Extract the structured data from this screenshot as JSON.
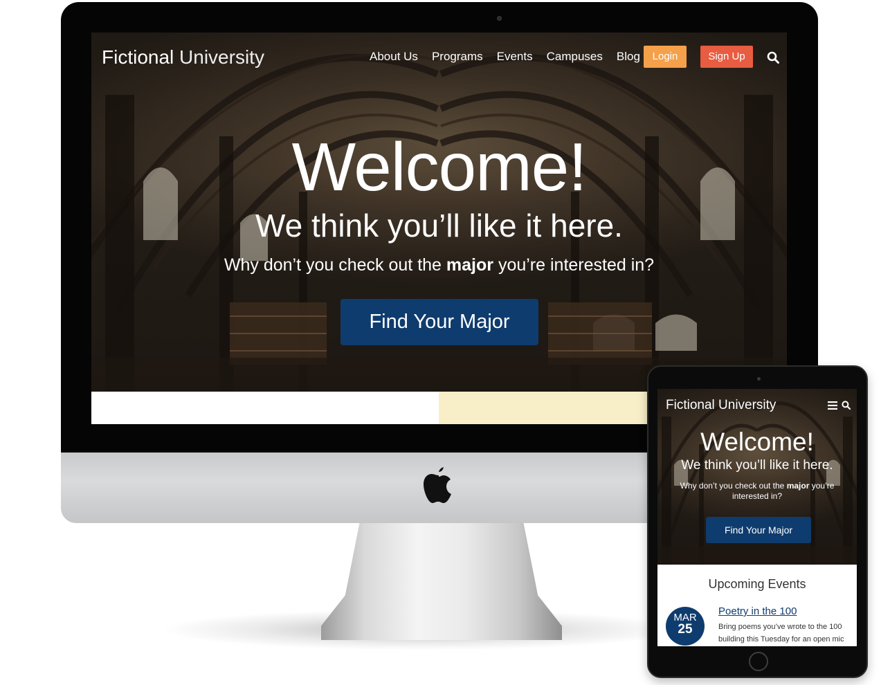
{
  "desktop": {
    "logo": {
      "bold": "Fictional",
      "light": "University"
    },
    "nav": [
      "About Us",
      "Programs",
      "Events",
      "Campuses",
      "Blog"
    ],
    "login_label": "Login",
    "signup_label": "Sign Up",
    "hero": {
      "title": "Welcome!",
      "subtitle": "We think you’ll like it here.",
      "line_before": "Why don’t you check out the ",
      "line_bold": "major",
      "line_after": " you’re interested in?",
      "button_label": "Find Your Major"
    }
  },
  "tablet": {
    "logo": {
      "bold": "Fictional",
      "light": "University"
    },
    "hero": {
      "title": "Welcome!",
      "subtitle": "We think you’ll like it here.",
      "line_before": "Why don’t you check out the ",
      "line_bold": "major",
      "line_after": " you’re interested in?",
      "button_label": "Find Your Major"
    },
    "events": {
      "heading": "Upcoming Events",
      "items": [
        {
          "month": "MAR",
          "day": "25",
          "title": "Poetry in the 100",
          "description": "Bring poems you’ve wrote to the 100 building this Tuesday for an open mic"
        }
      ]
    }
  },
  "colors": {
    "primary_blue": "#0f3c6e",
    "login_orange": "#f5a04a",
    "signup_red": "#e85c41",
    "accent_cream": "#f8efc8"
  },
  "icons": [
    "apple-logo-icon",
    "search-icon",
    "menu-icon"
  ]
}
